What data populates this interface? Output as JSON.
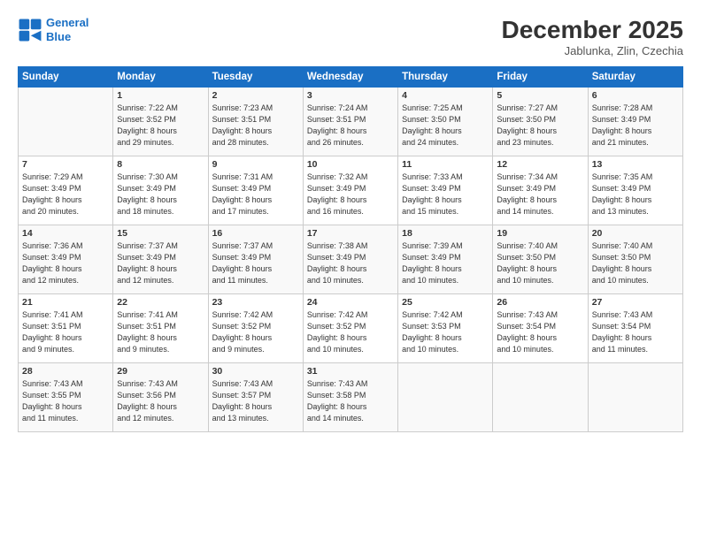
{
  "logo": {
    "line1": "General",
    "line2": "Blue"
  },
  "title": "December 2025",
  "subtitle": "Jablunka, Zlin, Czechia",
  "days_header": [
    "Sunday",
    "Monday",
    "Tuesday",
    "Wednesday",
    "Thursday",
    "Friday",
    "Saturday"
  ],
  "weeks": [
    [
      {
        "num": "",
        "info": ""
      },
      {
        "num": "1",
        "info": "Sunrise: 7:22 AM\nSunset: 3:52 PM\nDaylight: 8 hours\nand 29 minutes."
      },
      {
        "num": "2",
        "info": "Sunrise: 7:23 AM\nSunset: 3:51 PM\nDaylight: 8 hours\nand 28 minutes."
      },
      {
        "num": "3",
        "info": "Sunrise: 7:24 AM\nSunset: 3:51 PM\nDaylight: 8 hours\nand 26 minutes."
      },
      {
        "num": "4",
        "info": "Sunrise: 7:25 AM\nSunset: 3:50 PM\nDaylight: 8 hours\nand 24 minutes."
      },
      {
        "num": "5",
        "info": "Sunrise: 7:27 AM\nSunset: 3:50 PM\nDaylight: 8 hours\nand 23 minutes."
      },
      {
        "num": "6",
        "info": "Sunrise: 7:28 AM\nSunset: 3:49 PM\nDaylight: 8 hours\nand 21 minutes."
      }
    ],
    [
      {
        "num": "7",
        "info": "Sunrise: 7:29 AM\nSunset: 3:49 PM\nDaylight: 8 hours\nand 20 minutes."
      },
      {
        "num": "8",
        "info": "Sunrise: 7:30 AM\nSunset: 3:49 PM\nDaylight: 8 hours\nand 18 minutes."
      },
      {
        "num": "9",
        "info": "Sunrise: 7:31 AM\nSunset: 3:49 PM\nDaylight: 8 hours\nand 17 minutes."
      },
      {
        "num": "10",
        "info": "Sunrise: 7:32 AM\nSunset: 3:49 PM\nDaylight: 8 hours\nand 16 minutes."
      },
      {
        "num": "11",
        "info": "Sunrise: 7:33 AM\nSunset: 3:49 PM\nDaylight: 8 hours\nand 15 minutes."
      },
      {
        "num": "12",
        "info": "Sunrise: 7:34 AM\nSunset: 3:49 PM\nDaylight: 8 hours\nand 14 minutes."
      },
      {
        "num": "13",
        "info": "Sunrise: 7:35 AM\nSunset: 3:49 PM\nDaylight: 8 hours\nand 13 minutes."
      }
    ],
    [
      {
        "num": "14",
        "info": "Sunrise: 7:36 AM\nSunset: 3:49 PM\nDaylight: 8 hours\nand 12 minutes."
      },
      {
        "num": "15",
        "info": "Sunrise: 7:37 AM\nSunset: 3:49 PM\nDaylight: 8 hours\nand 12 minutes."
      },
      {
        "num": "16",
        "info": "Sunrise: 7:37 AM\nSunset: 3:49 PM\nDaylight: 8 hours\nand 11 minutes."
      },
      {
        "num": "17",
        "info": "Sunrise: 7:38 AM\nSunset: 3:49 PM\nDaylight: 8 hours\nand 10 minutes."
      },
      {
        "num": "18",
        "info": "Sunrise: 7:39 AM\nSunset: 3:49 PM\nDaylight: 8 hours\nand 10 minutes."
      },
      {
        "num": "19",
        "info": "Sunrise: 7:40 AM\nSunset: 3:50 PM\nDaylight: 8 hours\nand 10 minutes."
      },
      {
        "num": "20",
        "info": "Sunrise: 7:40 AM\nSunset: 3:50 PM\nDaylight: 8 hours\nand 10 minutes."
      }
    ],
    [
      {
        "num": "21",
        "info": "Sunrise: 7:41 AM\nSunset: 3:51 PM\nDaylight: 8 hours\nand 9 minutes."
      },
      {
        "num": "22",
        "info": "Sunrise: 7:41 AM\nSunset: 3:51 PM\nDaylight: 8 hours\nand 9 minutes."
      },
      {
        "num": "23",
        "info": "Sunrise: 7:42 AM\nSunset: 3:52 PM\nDaylight: 8 hours\nand 9 minutes."
      },
      {
        "num": "24",
        "info": "Sunrise: 7:42 AM\nSunset: 3:52 PM\nDaylight: 8 hours\nand 10 minutes."
      },
      {
        "num": "25",
        "info": "Sunrise: 7:42 AM\nSunset: 3:53 PM\nDaylight: 8 hours\nand 10 minutes."
      },
      {
        "num": "26",
        "info": "Sunrise: 7:43 AM\nSunset: 3:54 PM\nDaylight: 8 hours\nand 10 minutes."
      },
      {
        "num": "27",
        "info": "Sunrise: 7:43 AM\nSunset: 3:54 PM\nDaylight: 8 hours\nand 11 minutes."
      }
    ],
    [
      {
        "num": "28",
        "info": "Sunrise: 7:43 AM\nSunset: 3:55 PM\nDaylight: 8 hours\nand 11 minutes."
      },
      {
        "num": "29",
        "info": "Sunrise: 7:43 AM\nSunset: 3:56 PM\nDaylight: 8 hours\nand 12 minutes."
      },
      {
        "num": "30",
        "info": "Sunrise: 7:43 AM\nSunset: 3:57 PM\nDaylight: 8 hours\nand 13 minutes."
      },
      {
        "num": "31",
        "info": "Sunrise: 7:43 AM\nSunset: 3:58 PM\nDaylight: 8 hours\nand 14 minutes."
      },
      {
        "num": "",
        "info": ""
      },
      {
        "num": "",
        "info": ""
      },
      {
        "num": "",
        "info": ""
      }
    ]
  ]
}
